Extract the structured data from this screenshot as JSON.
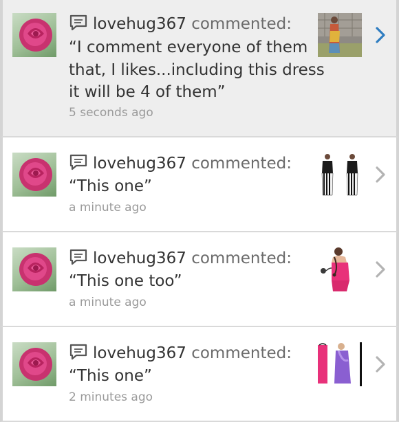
{
  "notifications": [
    {
      "user": "lovehug367",
      "action": "commented:",
      "comment_lines": [
        "“I comment everyone of them",
        "that, I likes...including this dress",
        "it will be 4 of them”"
      ],
      "time": "5 seconds ago",
      "highlighted": true
    },
    {
      "user": "lovehug367",
      "action": "commented:",
      "comment_lines": [
        "“This one”"
      ],
      "time": "a minute ago",
      "highlighted": false
    },
    {
      "user": "lovehug367",
      "action": "commented:",
      "comment_lines": [
        "“This one too”"
      ],
      "time": "a minute ago",
      "highlighted": false
    },
    {
      "user": "lovehug367",
      "action": "commented:",
      "comment_lines": [
        "“This one”"
      ],
      "time": "2 minutes ago",
      "highlighted": false
    }
  ],
  "icons": {
    "avatar": "rose-avatar-icon",
    "bubble": "comment-bubble-icon",
    "chevron": "chevron-right-icon"
  },
  "colors": {
    "chevron_active": "#2f7dc1",
    "chevron_inactive": "#b3b3b3",
    "username": "#333333",
    "action": "#6b6b6b",
    "timestamp": "#9a9a9a",
    "highlight_bg": "#eeeeee"
  }
}
